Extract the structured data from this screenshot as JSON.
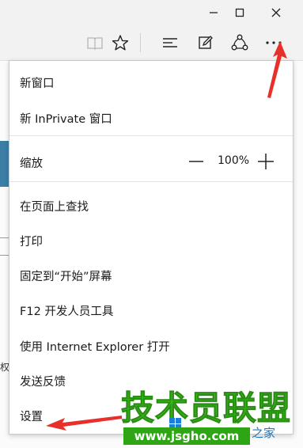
{
  "window_controls": {
    "minimize_icon": "minimize-icon",
    "maximize_icon": "maximize-icon",
    "close_icon": "close-icon"
  },
  "toolbar": {
    "icons": [
      "reading-view-icon",
      "favorite-star-icon",
      "hub-icon",
      "web-note-icon",
      "share-icon",
      "more-icon"
    ]
  },
  "menu": {
    "items": [
      {
        "label": "新窗口"
      },
      {
        "label": "新 InPrivate 窗口"
      },
      {
        "label": "缩放"
      },
      {
        "label": "在页面上查找"
      },
      {
        "label": "打印"
      },
      {
        "label": "固定到“开始”屏幕"
      },
      {
        "label": "F12 开发人员工具"
      },
      {
        "label": "使用 Internet Explorer 打开"
      },
      {
        "label": "发送反馈"
      },
      {
        "label": "设置"
      }
    ],
    "zoom_level": "100%"
  },
  "background_text": "权",
  "watermark": {
    "title": "技术员联盟",
    "url": "www.jsgho.com",
    "side_text": "之家"
  },
  "colors": {
    "annotation_arrow": "#e8302b",
    "watermark_green": "#3ac11c",
    "chrome_bg": "#f2f2f2"
  }
}
